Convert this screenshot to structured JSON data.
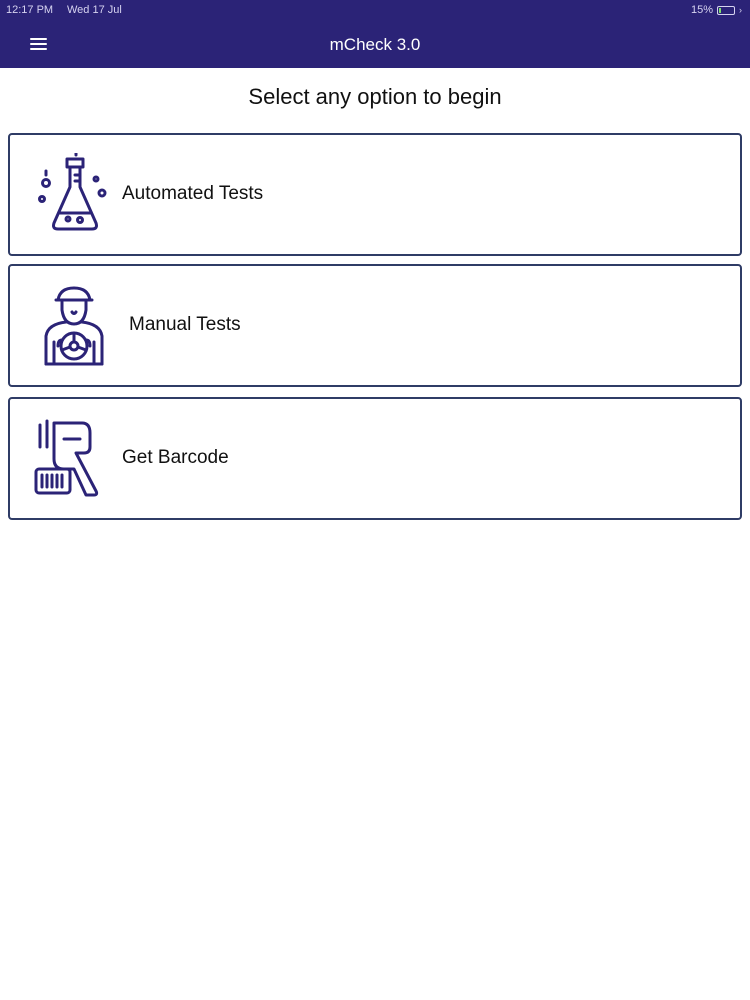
{
  "status_bar": {
    "time": "12:17 PM",
    "date": "Wed 17 Jul",
    "battery_percent": "15%",
    "battery_level": 0.15,
    "charging": true
  },
  "header": {
    "title": "mCheck 3.0",
    "menu_icon": "hamburger-menu-icon"
  },
  "main": {
    "prompt": "Select any option to begin",
    "options": [
      {
        "label": "Automated Tests",
        "icon": "flask-icon"
      },
      {
        "label": "Manual Tests",
        "icon": "technician-icon"
      },
      {
        "label": "Get Barcode",
        "icon": "barcode-scanner-icon"
      }
    ]
  },
  "colors": {
    "header_background": "#2b2377",
    "card_border": "#2f3c66",
    "icon_color": "#2b2377"
  }
}
